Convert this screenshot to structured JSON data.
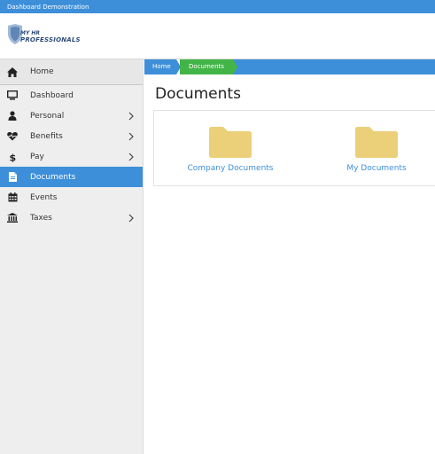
{
  "topbar": {
    "title": "Dashboard Demonstration"
  },
  "logo": {
    "line1": "MY HR",
    "line2": "PROFESSIONALS",
    "icon": "shield-logo"
  },
  "colors": {
    "accent": "#3d8fd9",
    "breadcrumb_active": "#43b548",
    "folder": "#ebd079",
    "sidebar_bg": "#eeeeee"
  },
  "sidebar": {
    "items": [
      {
        "label": "Home",
        "icon": "home-icon"
      },
      {
        "label": "Dashboard",
        "icon": "monitor-icon"
      },
      {
        "label": "Personal",
        "icon": "user-icon",
        "expandable": true
      },
      {
        "label": "Benefits",
        "icon": "heartbeat-icon",
        "expandable": true
      },
      {
        "label": "Pay",
        "icon": "dollar-icon",
        "expandable": true
      },
      {
        "label": "Documents",
        "icon": "document-icon",
        "active": true
      },
      {
        "label": "Events",
        "icon": "calendar-icon"
      },
      {
        "label": "Taxes",
        "icon": "bank-icon",
        "expandable": true
      }
    ]
  },
  "breadcrumb": {
    "items": [
      "Home",
      "Documents"
    ]
  },
  "main": {
    "title": "Documents",
    "folders": [
      {
        "label": "Company Documents",
        "icon": "folder-icon"
      },
      {
        "label": "My Documents",
        "icon": "folder-icon"
      }
    ]
  }
}
